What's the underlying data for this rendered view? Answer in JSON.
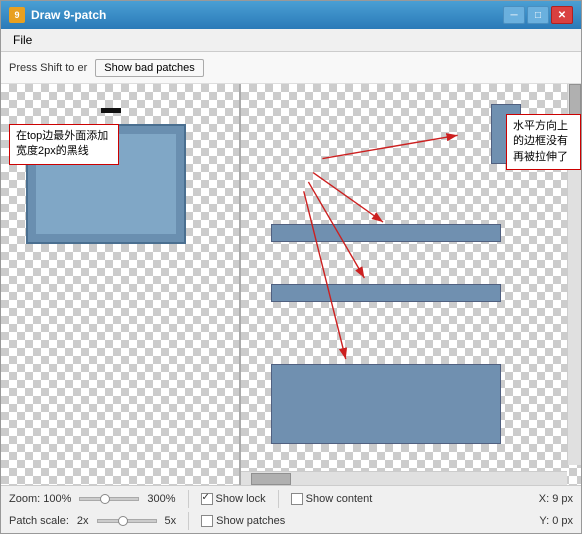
{
  "window": {
    "title": "Draw 9-patch",
    "icon": "9"
  },
  "title_buttons": {
    "minimize": "─",
    "restore": "□",
    "close": "✕"
  },
  "menu": {
    "file_label": "File"
  },
  "toolbar": {
    "hint_text": "Press Shift to er",
    "bad_patches_btn": "Show bad patches"
  },
  "tooltips": {
    "left": "在top边最外面添加宽度2px的黑线",
    "right": "水平方向上的边框没有再被拉伸了"
  },
  "status_bar": {
    "zoom_label": "Zoom: 100%",
    "zoom_max": "300%",
    "show_lock_label": "Show lock",
    "show_content_label": "Show content",
    "x_label": "X: 9 px",
    "patch_scale_label": "Patch scale:",
    "patch_scale_min": "2x",
    "patch_scale_max": "5x",
    "show_patches_label": "Show patches",
    "y_label": "Y: 0 px"
  }
}
